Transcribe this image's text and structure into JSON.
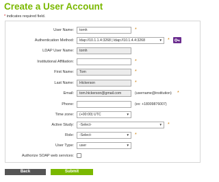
{
  "page": {
    "title": "Create a User Account",
    "required_note_star": "*",
    "required_note": "indicates required field."
  },
  "form": {
    "user_name": {
      "label": "User Name:",
      "value": "tomh"
    },
    "auth_method": {
      "label": "Authentication Method:",
      "value": "ldap://10.1.1.4:3268 | ldap://10.1.4.4:3268"
    },
    "ldap_user_name": {
      "label": "LDAP User Name:",
      "value": "tomh"
    },
    "institutional_affiliation": {
      "label": "Institutional Affiliation:",
      "value": ""
    },
    "first_name": {
      "label": "First Name:",
      "value": "Tom"
    },
    "last_name": {
      "label": "Last Name:",
      "value": "Hickerson"
    },
    "email": {
      "label": "Email:",
      "value": "tom.hickerson@gmail.com",
      "hint": "(username@institution)"
    },
    "phone": {
      "label": "Phone:",
      "value": "",
      "hint": "(ex: +18009876007)"
    },
    "time_zone": {
      "label": "Time zone:",
      "value": "(+00:00) UTC"
    },
    "active_study": {
      "label": "Active Study:",
      "value": "-Select-"
    },
    "role": {
      "label": "Role:",
      "value": "-Select-"
    },
    "user_type": {
      "label": "User Type:",
      "value": "user"
    },
    "soap": {
      "label": "Authorize SOAP web services:",
      "checked": false
    },
    "required_marker": "*"
  },
  "buttons": {
    "back": "Back",
    "submit": "Submit"
  },
  "colors": {
    "accent": "#7ab800",
    "required": "#cc7a00",
    "key_button": "#6b2d8f",
    "back_button": "#555555"
  },
  "icons": {
    "auth_button": "key-icon"
  }
}
